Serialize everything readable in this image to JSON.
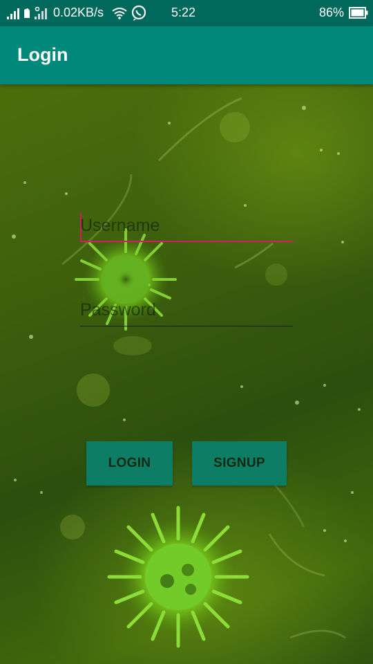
{
  "status_bar": {
    "network_speed": "0.02KB/s",
    "time": "5:22",
    "battery": "86%",
    "icons": [
      "signal-icon",
      "signal-icon",
      "wifi-icon",
      "whatsapp-icon",
      "battery-icon"
    ]
  },
  "app_bar": {
    "title": "Login"
  },
  "form": {
    "username": {
      "placeholder": "Username",
      "value": ""
    },
    "password": {
      "placeholder": "Password",
      "value": ""
    },
    "login_label": "LOGIN",
    "signup_label": "SIGNUP"
  },
  "colors": {
    "status_bar": "#00695c",
    "app_bar": "#00897b",
    "button": "#0e7d66",
    "focus_accent": "#d81b60"
  }
}
